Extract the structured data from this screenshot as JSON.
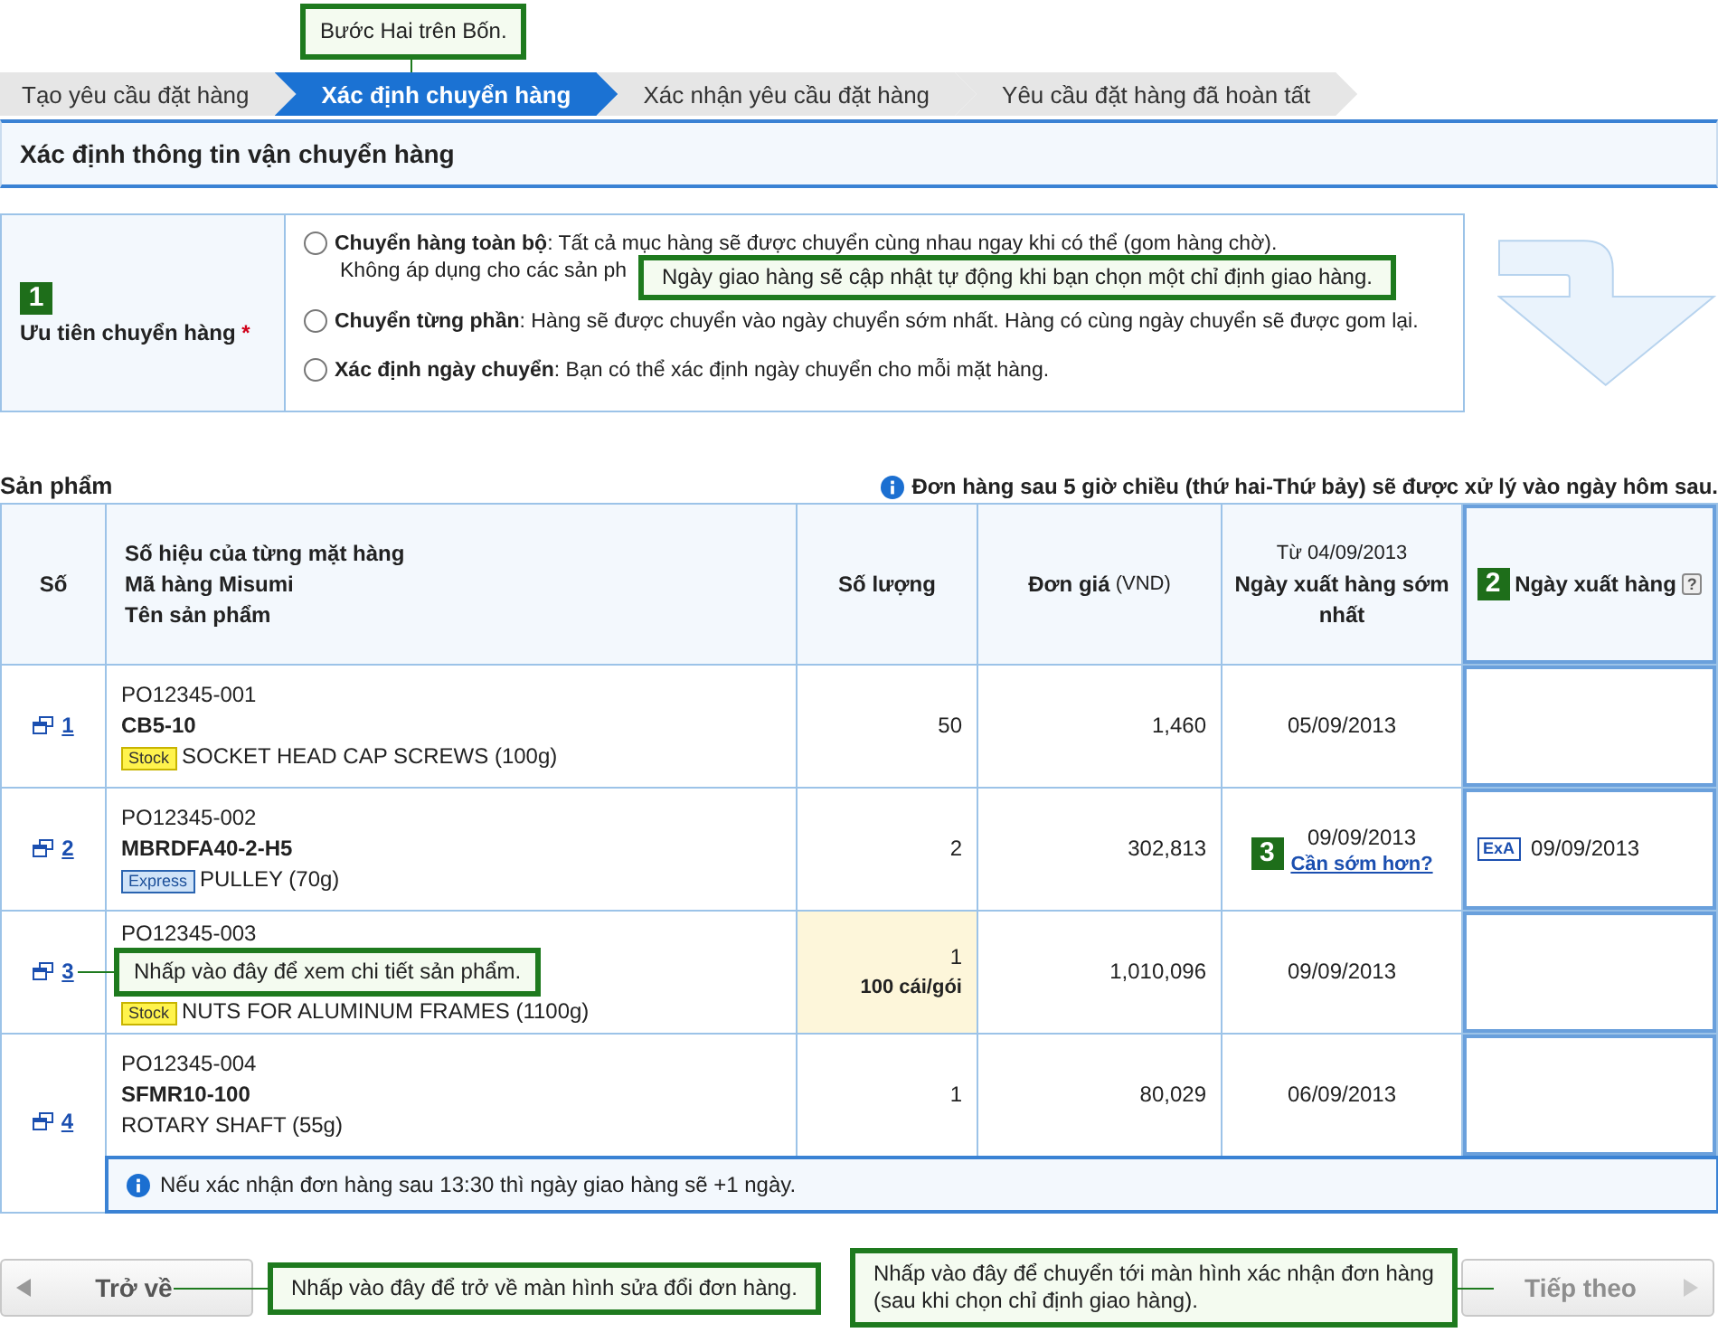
{
  "step_note": "Bước Hai trên Bốn.",
  "steps": [
    {
      "label": "Tạo yêu cầu đặt hàng",
      "selected": false
    },
    {
      "label": "Xác định chuyển hàng",
      "selected": true
    },
    {
      "label": "Xác nhận yêu cầu đặt hàng",
      "selected": false
    },
    {
      "label": "Yêu cầu đặt hàng đã hoàn tất",
      "selected": false
    }
  ],
  "section_title": "Xác định thông tin vận chuyển hàng",
  "priority": {
    "badge": "1",
    "label": "Ưu tiên chuyển hàng",
    "required_mark": "*",
    "options": [
      {
        "title": "Chuyển hàng toàn bộ",
        "text": ": Tất cả mục hàng sẽ được chuyển cùng nhau ngay khi có thể (gom hàng chờ).",
        "extra": "Không áp dụng cho các sản ph",
        "selected": false
      },
      {
        "title": "Chuyển từng phần",
        "text": ": Hàng sẽ được chuyển vào ngày chuyển sớm nhất. Hàng có cùng ngày chuyển sẽ được gom lại.",
        "selected": false
      },
      {
        "title": "Xác định ngày chuyển",
        "text": ": Bạn có thể xác định ngày chuyển cho mỗi mặt hàng.",
        "selected": false
      }
    ],
    "note": "Ngày giao hàng sẽ cập nhật tự động khi bạn chọn một chỉ định giao hàng."
  },
  "products": {
    "title": "Sản phẩm",
    "notice": "Đơn hàng sau 5 giờ chiều (thứ hai-Thứ bảy) sẽ được xử lý vào ngày hôm sau.",
    "columns": {
      "number": "Số",
      "item": [
        "Số hiệu của từng mặt hàng",
        "Mã hàng Misumi",
        "Tên sản phẩm"
      ],
      "quantity": "Số lượng",
      "price": "Đơn giá",
      "price_unit": "(VND)",
      "earliest_from": "Từ 04/09/2013",
      "earliest": "Ngày xuất hàng sớm nhất",
      "ship_badge": "2",
      "ship": "Ngày xuất hàng",
      "ship_help": "?"
    },
    "rows": [
      {
        "no": "1",
        "part": "PO12345-001",
        "code": "CB5-10",
        "tag": {
          "kind": "stock",
          "label": "Stock"
        },
        "name": "SOCKET HEAD CAP SCREWS (100g)",
        "qty": "50",
        "qty_highlight": false,
        "price": "1,460",
        "earliest": "05/09/2013"
      },
      {
        "no": "2",
        "part": "PO12345-002",
        "code": "MBRDFA40-2-H5",
        "tag": {
          "kind": "express",
          "label": "Express"
        },
        "name": "PULLEY (70g)",
        "qty": "2",
        "qty_highlight": false,
        "price": "302,813",
        "earliest_badge": "3",
        "earliest": "09/09/2013",
        "earliest_link": "Cần sớm hơn?",
        "ship_mark": "ExA",
        "ship": "09/09/2013"
      },
      {
        "no": "3",
        "part": "PO12345-003",
        "tag": {
          "kind": "stock",
          "label": "Stock"
        },
        "name": "NUTS FOR ALUMINUM FRAMES (1100g)",
        "qty": "1",
        "qty_unit": "100 cái/gói",
        "qty_highlight": true,
        "price": "1,010,096",
        "earliest": "09/09/2013",
        "callout": "Nhấp vào đây để xem chi tiết sản phẩm."
      },
      {
        "no": "4",
        "part": "PO12345-004",
        "code": "SFMR10-100",
        "name": "ROTARY SHAFT (55g)",
        "qty": "1",
        "qty_highlight": false,
        "price": "80,029",
        "earliest": "06/09/2013"
      }
    ],
    "footer_note": "Nếu xác nhận đơn hàng sau 13:30 thì ngày giao hàng sẽ +1 ngày."
  },
  "back": {
    "label": "Trở về",
    "disabled": false,
    "note": "Nhấp vào đây để trở về màn hình sửa đổi đơn hàng."
  },
  "next": {
    "label": "Tiếp theo",
    "disabled": true,
    "note": "Nhấp vào đây để chuyển tới màn hình xác nhận đơn hàng (sau khi chọn chỉ định giao hàng)."
  }
}
